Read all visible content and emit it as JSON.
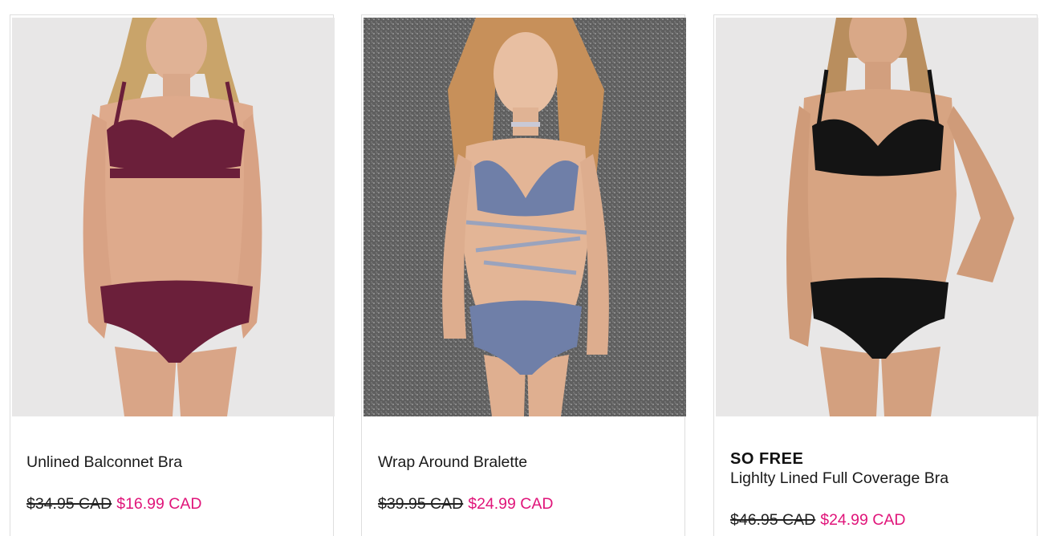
{
  "products": [
    {
      "image_alt": "Unlined Balconnet Bra product photo",
      "brand": "",
      "name": "Unlined Balconnet Bra",
      "original_price": "$34.95 CAD",
      "sale_price": "$16.99 CAD"
    },
    {
      "image_alt": "Wrap Around Bralette product photo",
      "brand": "",
      "name": "Wrap Around Bralette",
      "original_price": "$39.95 CAD",
      "sale_price": "$24.99 CAD"
    },
    {
      "image_alt": "Lighlty Lined Full Coverage Bra product photo",
      "brand": "SO FREE",
      "name": "Lighlty Lined Full Coverage Bra",
      "original_price": "$46.95 CAD",
      "sale_price": "$24.99 CAD"
    }
  ],
  "colors": {
    "sale_price": "#e0157a",
    "card_border": "#dedede",
    "photo_bg_light": "#e8e7e7",
    "photo_bg_glitter": "#6e6e6e",
    "set_burgundy": "#6b1f3a",
    "set_blue": "#6f7fa8",
    "set_black": "#141414"
  }
}
